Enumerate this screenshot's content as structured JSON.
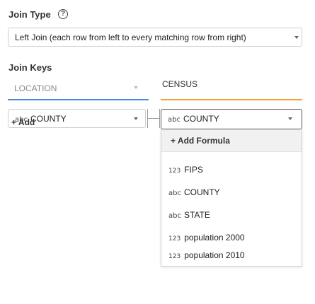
{
  "join_type": {
    "label": "Join Type",
    "help_icon": "?",
    "selected": "Left Join (each row from left to every matching row from right)"
  },
  "join_keys": {
    "label": "Join Keys",
    "left_table": "LOCATION",
    "right_table": "CENSUS",
    "left_key": {
      "type": "abc",
      "value": "COUNTY"
    },
    "right_key": {
      "type": "abc",
      "value": "COUNTY"
    },
    "add_label": "+ Add"
  },
  "dropdown": {
    "add_formula": "+ Add Formula",
    "options": [
      {
        "type": "123",
        "label": "FIPS"
      },
      {
        "type": "abc",
        "label": "COUNTY"
      },
      {
        "type": "abc",
        "label": "STATE"
      },
      {
        "type": "123",
        "label": "population 2000"
      },
      {
        "type": "123",
        "label": "population 2010"
      }
    ]
  },
  "colors": {
    "left_underline": "#4a8ad6",
    "right_underline": "#f0a23a",
    "focus_border": "#555555"
  }
}
